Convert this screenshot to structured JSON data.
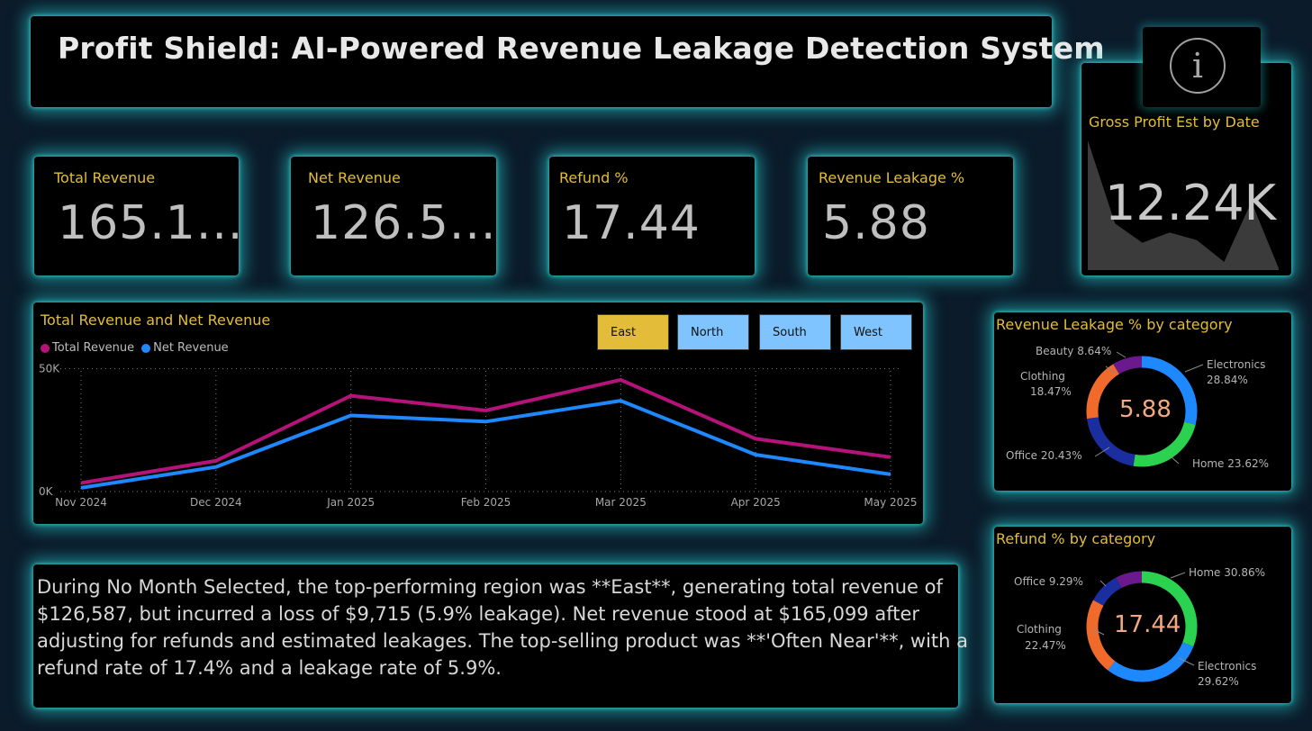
{
  "title": "Profit Shield: AI-Powered Revenue Leakage Detection System",
  "colors": {
    "accent": "#e3bd3a",
    "glow": "#28dcdc",
    "total_revenue": "#b5127a",
    "net_revenue": "#1e88ff"
  },
  "kpis": [
    {
      "label": "Total Revenue",
      "value": "165.1..."
    },
    {
      "label": "Net Revenue",
      "value": "126.5..."
    },
    {
      "label": "Refund %",
      "value": "17.44"
    },
    {
      "label": "Revenue Leakage %",
      "value": "5.88"
    }
  ],
  "gross_profit": {
    "label": "Gross Profit Est by Date",
    "value": "12.24K",
    "sparkline": [
      100,
      35,
      20,
      28,
      22,
      5,
      52,
      0
    ]
  },
  "info_icon": "info-icon",
  "line_chart": {
    "chart_data": {
      "type": "line",
      "title": "Total Revenue and Net Revenue",
      "x": [
        "Nov 2024",
        "Dec 2024",
        "Jan 2025",
        "Feb 2025",
        "Mar 2025",
        "Apr 2025",
        "May 2025"
      ],
      "series": [
        {
          "name": "Total Revenue",
          "values": [
            3500,
            12500,
            39000,
            33000,
            45500,
            21500,
            14000
          ]
        },
        {
          "name": "Net Revenue",
          "values": [
            1500,
            10000,
            31000,
            28500,
            37000,
            15000,
            7000
          ]
        }
      ],
      "ylim": [
        0,
        55000
      ],
      "yticks": [
        "0K",
        "50K"
      ],
      "legend": "top-left",
      "grid": true
    },
    "slicers": [
      {
        "label": "East",
        "selected": true
      },
      {
        "label": "North",
        "selected": false
      },
      {
        "label": "South",
        "selected": false
      },
      {
        "label": "West",
        "selected": false
      }
    ]
  },
  "narrative": "During No Month Selected, the top-performing region was **East**, generating total revenue of $126,587, but incurred a loss of $9,715 (5.9% leakage). Net revenue stood at $165,099 after adjusting for refunds and estimated leakages. The top-selling product was **'Often Near'**, with a refund rate of 17.4% and a leakage rate of 5.9%.",
  "leakage_donut": {
    "title": "Revenue Leakage % by category",
    "center": "5.88",
    "chart_data": {
      "type": "pie",
      "categories": [
        "Electronics",
        "Home",
        "Office",
        "Clothing",
        "Beauty"
      ],
      "values": [
        28.84,
        23.62,
        20.43,
        18.47,
        8.64
      ],
      "colors": [
        "#1e88ff",
        "#2ad24f",
        "#1a2ea0",
        "#f06b2b",
        "#6a1a8c"
      ]
    },
    "labels": [
      "Electronics",
      "28.84%",
      "Home 23.62%",
      "Office 20.43%",
      "Clothing",
      "18.47%",
      "Beauty 8.64%"
    ]
  },
  "refund_donut": {
    "title": "Refund % by category",
    "center": "17.44",
    "chart_data": {
      "type": "pie",
      "categories": [
        "Home",
        "Electronics",
        "Clothing",
        "Office",
        "Beauty"
      ],
      "values": [
        30.86,
        29.62,
        22.47,
        9.29,
        7.76
      ],
      "colors": [
        "#2ad24f",
        "#1e88ff",
        "#f06b2b",
        "#1a2ea0",
        "#6a1a8c"
      ]
    },
    "labels": [
      "Home 30.86%",
      "Electronics",
      "29.62%",
      "Clothing",
      "22.47%",
      "Office 9.29%"
    ]
  }
}
